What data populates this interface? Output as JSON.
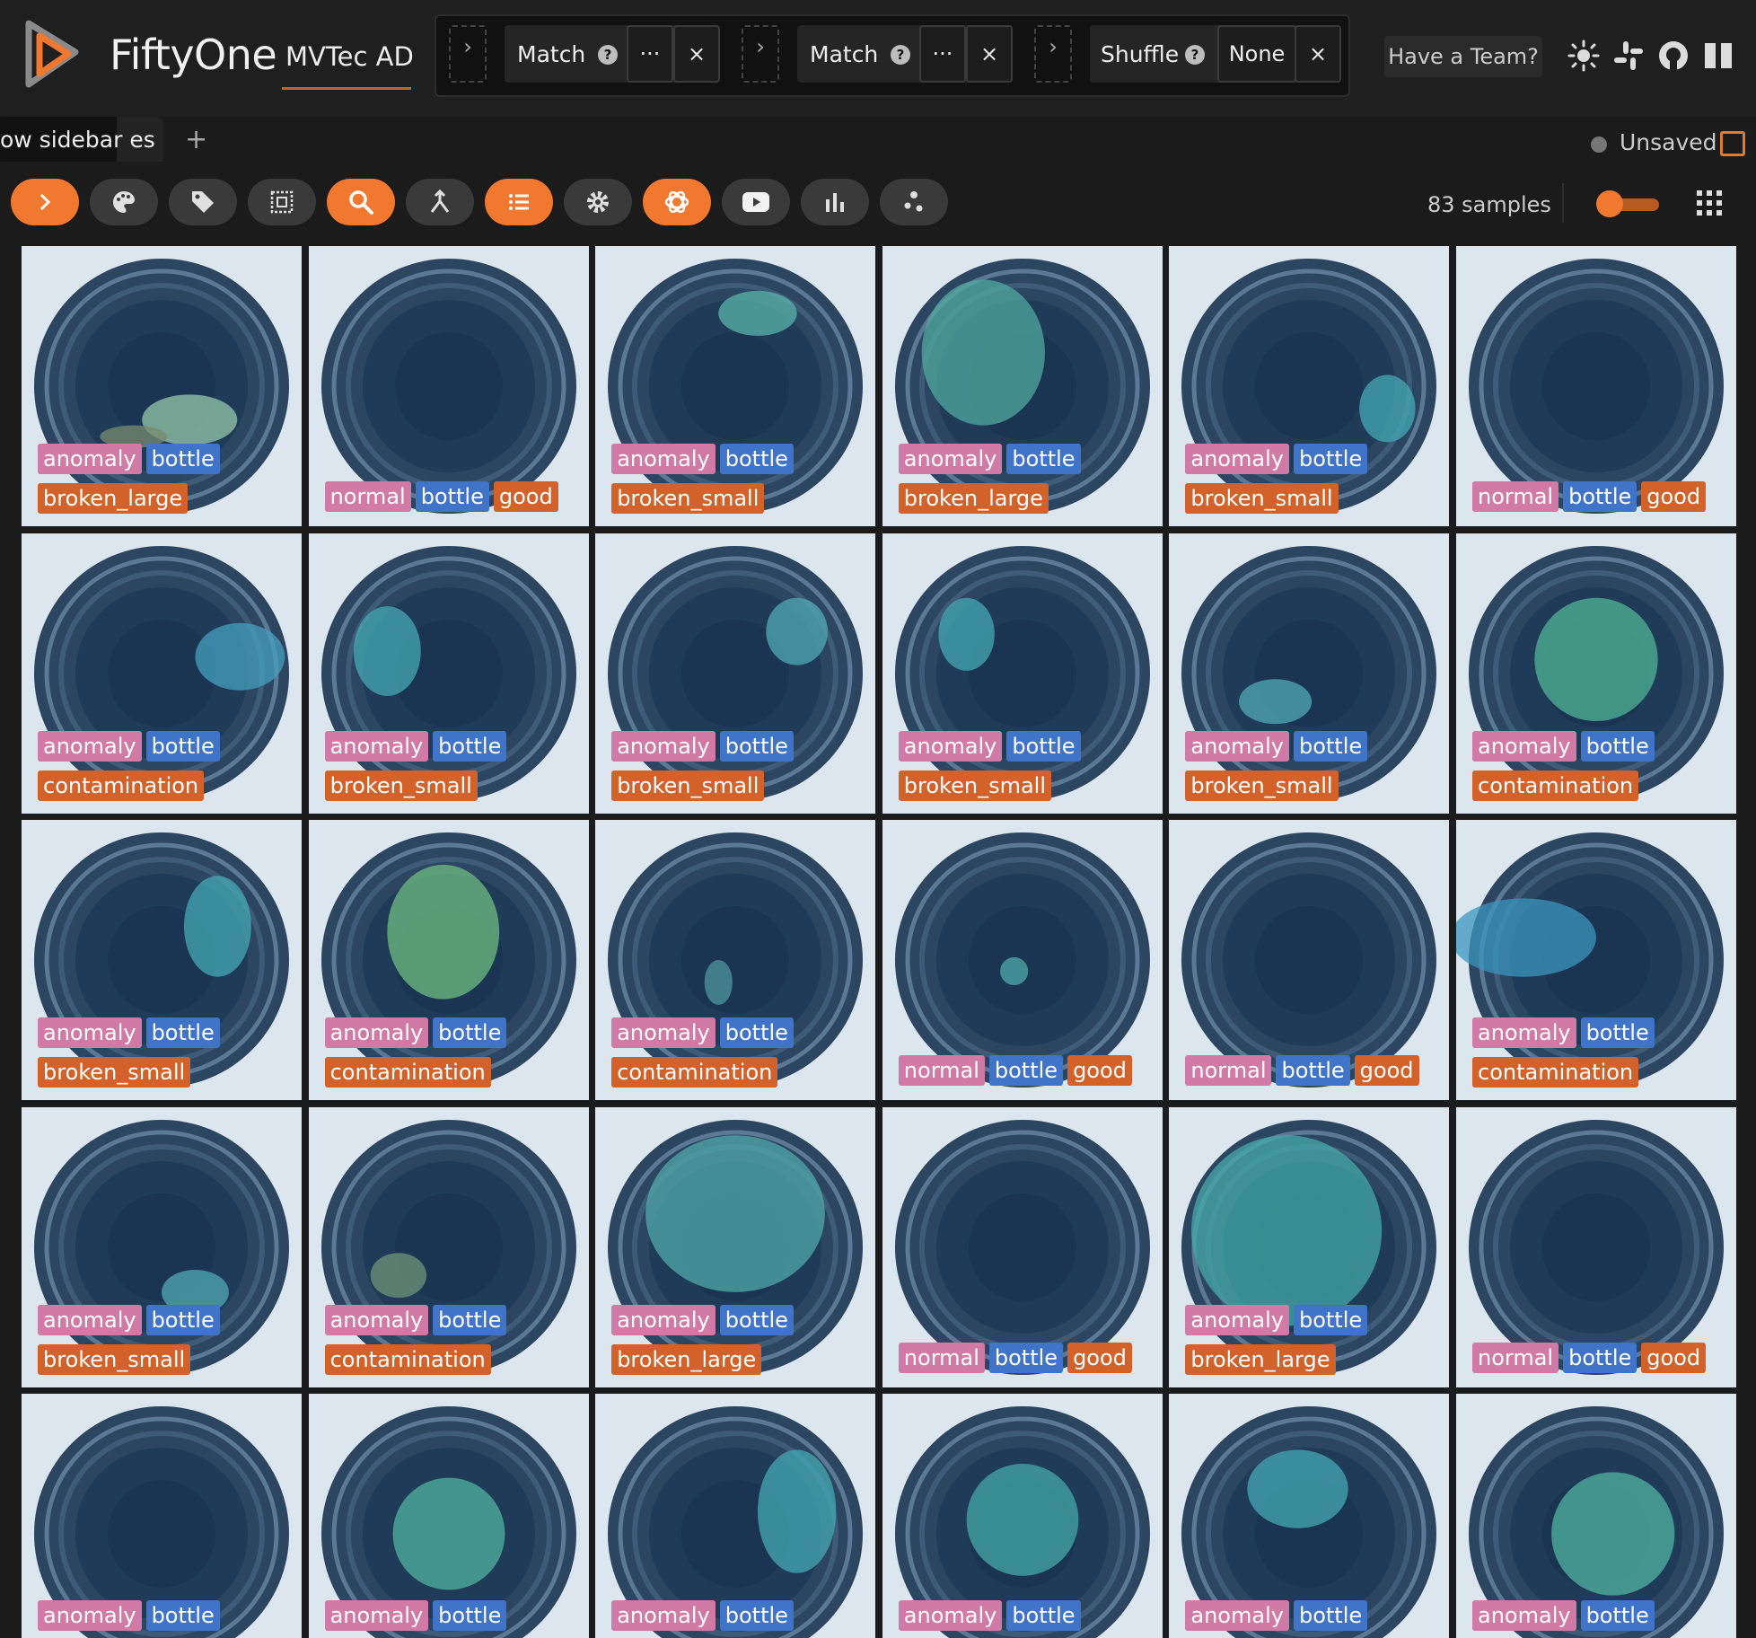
{
  "app": {
    "brand": "FiftyOne",
    "dataset": "MVTec AD"
  },
  "view_bar": {
    "stages": [
      {
        "label": "Match",
        "value": "···"
      },
      {
        "label": "Match",
        "value": "···"
      },
      {
        "label": "Shuffle",
        "value": "None"
      }
    ],
    "help": "?",
    "close": "×",
    "arrow": "›"
  },
  "header": {
    "team_button": "Have a Team?"
  },
  "tabs": {
    "tab_label": "ow sidebar es",
    "add": "+",
    "status": "Unsaved"
  },
  "toolbar": {
    "sample_count": "83 samples"
  },
  "colors": {
    "accent": "#f0782f",
    "anomaly": "#d17aa6",
    "bottle": "#3f74c8",
    "label": "#d2622a"
  },
  "samples": [
    {
      "tags": [
        "anomaly",
        "bottle"
      ],
      "label": "broken_large",
      "blobs": [
        [
          0.6,
          0.62,
          0.17,
          0.09,
          [
            150,
            200,
            170
          ]
        ],
        [
          0.4,
          0.68,
          0.12,
          0.04,
          [
            120,
            140,
            110
          ]
        ]
      ]
    },
    {
      "tags": [
        "normal",
        "bottle"
      ],
      "label": "good",
      "blobs": []
    },
    {
      "tags": [
        "anomaly",
        "bottle"
      ],
      "label": "broken_small",
      "blobs": [
        [
          0.58,
          0.24,
          0.14,
          0.08,
          [
            90,
            180,
            170
          ]
        ]
      ]
    },
    {
      "tags": [
        "anomaly",
        "bottle"
      ],
      "label": "broken_large",
      "blobs": [
        [
          0.36,
          0.38,
          0.22,
          0.26,
          [
            80,
            170,
            160
          ]
        ]
      ]
    },
    {
      "tags": [
        "anomaly",
        "bottle"
      ],
      "label": "broken_small",
      "blobs": [
        [
          0.78,
          0.58,
          0.1,
          0.12,
          [
            70,
            170,
            180
          ]
        ]
      ]
    },
    {
      "tags": [
        "normal",
        "bottle"
      ],
      "label": "good",
      "blobs": []
    },
    {
      "tags": [
        "anomaly",
        "bottle"
      ],
      "label": "contamination",
      "blobs": [
        [
          0.78,
          0.44,
          0.16,
          0.12,
          [
            70,
            160,
            190
          ]
        ]
      ]
    },
    {
      "tags": [
        "anomaly",
        "bottle"
      ],
      "label": "broken_small",
      "blobs": [
        [
          0.28,
          0.42,
          0.12,
          0.16,
          [
            70,
            170,
            180
          ]
        ]
      ]
    },
    {
      "tags": [
        "anomaly",
        "bottle"
      ],
      "label": "broken_small",
      "blobs": [
        [
          0.72,
          0.35,
          0.11,
          0.12,
          [
            80,
            170,
            180
          ]
        ]
      ]
    },
    {
      "tags": [
        "anomaly",
        "bottle"
      ],
      "label": "broken_small",
      "blobs": [
        [
          0.3,
          0.36,
          0.1,
          0.13,
          [
            70,
            170,
            180
          ]
        ]
      ]
    },
    {
      "tags": [
        "anomaly",
        "bottle"
      ],
      "label": "broken_small",
      "blobs": [
        [
          0.38,
          0.6,
          0.13,
          0.08,
          [
            80,
            170,
            180
          ]
        ]
      ]
    },
    {
      "tags": [
        "anomaly",
        "bottle"
      ],
      "label": "contamination",
      "blobs": [
        [
          0.5,
          0.45,
          0.22,
          0.22,
          [
            80,
            180,
            150
          ]
        ]
      ]
    },
    {
      "tags": [
        "anomaly",
        "bottle"
      ],
      "label": "broken_small",
      "blobs": [
        [
          0.7,
          0.38,
          0.12,
          0.18,
          [
            70,
            170,
            180
          ]
        ]
      ]
    },
    {
      "tags": [
        "anomaly",
        "bottle"
      ],
      "label": "contamination",
      "blobs": [
        [
          0.48,
          0.4,
          0.2,
          0.24,
          [
            110,
            190,
            130
          ]
        ]
      ]
    },
    {
      "tags": [
        "anomaly",
        "bottle"
      ],
      "label": "contamination",
      "blobs": [
        [
          0.44,
          0.58,
          0.05,
          0.08,
          [
            80,
            150,
            160
          ]
        ]
      ]
    },
    {
      "tags": [
        "normal",
        "bottle"
      ],
      "label": "good",
      "blobs": [
        [
          0.47,
          0.54,
          0.05,
          0.05,
          [
            80,
            170,
            170
          ]
        ]
      ]
    },
    {
      "tags": [
        "normal",
        "bottle"
      ],
      "label": "good",
      "blobs": []
    },
    {
      "tags": [
        "anomaly",
        "bottle"
      ],
      "label": "contamination",
      "blobs": [
        [
          0.24,
          0.42,
          0.26,
          0.14,
          [
            60,
            150,
            190
          ]
        ]
      ]
    },
    {
      "tags": [
        "anomaly",
        "bottle"
      ],
      "label": "broken_small",
      "blobs": [
        [
          0.62,
          0.66,
          0.12,
          0.08,
          [
            80,
            170,
            180
          ]
        ]
      ]
    },
    {
      "tags": [
        "anomaly",
        "bottle"
      ],
      "label": "contamination",
      "blobs": [
        [
          0.32,
          0.6,
          0.1,
          0.08,
          [
            110,
            150,
            120
          ]
        ]
      ]
    },
    {
      "tags": [
        "anomaly",
        "bottle"
      ],
      "label": "broken_large",
      "blobs": [
        [
          0.5,
          0.38,
          0.32,
          0.28,
          [
            80,
            170,
            170
          ]
        ]
      ]
    },
    {
      "tags": [
        "normal",
        "bottle"
      ],
      "label": "good",
      "blobs": []
    },
    {
      "tags": [
        "anomaly",
        "bottle"
      ],
      "label": "broken_large",
      "blobs": [
        [
          0.42,
          0.44,
          0.34,
          0.34,
          [
            70,
            170,
            170
          ]
        ]
      ]
    },
    {
      "tags": [
        "normal",
        "bottle"
      ],
      "label": "good",
      "blobs": []
    },
    {
      "tags": [
        "anomaly",
        "bottle"
      ],
      "label": "",
      "blobs": []
    },
    {
      "tags": [
        "anomaly",
        "bottle"
      ],
      "label": "",
      "blobs": [
        [
          0.5,
          0.5,
          0.2,
          0.2,
          [
            80,
            180,
            160
          ]
        ]
      ]
    },
    {
      "tags": [
        "anomaly",
        "bottle"
      ],
      "label": "",
      "blobs": [
        [
          0.72,
          0.42,
          0.14,
          0.22,
          [
            70,
            170,
            180
          ]
        ]
      ]
    },
    {
      "tags": [
        "anomaly",
        "bottle"
      ],
      "label": "",
      "blobs": [
        [
          0.5,
          0.45,
          0.2,
          0.2,
          [
            70,
            170,
            170
          ]
        ]
      ]
    },
    {
      "tags": [
        "anomaly",
        "bottle"
      ],
      "label": "",
      "blobs": [
        [
          0.46,
          0.34,
          0.18,
          0.14,
          [
            70,
            170,
            180
          ]
        ]
      ]
    },
    {
      "tags": [
        "anomaly",
        "bottle"
      ],
      "label": "",
      "blobs": [
        [
          0.56,
          0.5,
          0.22,
          0.22,
          [
            80,
            180,
            160
          ]
        ]
      ]
    }
  ]
}
